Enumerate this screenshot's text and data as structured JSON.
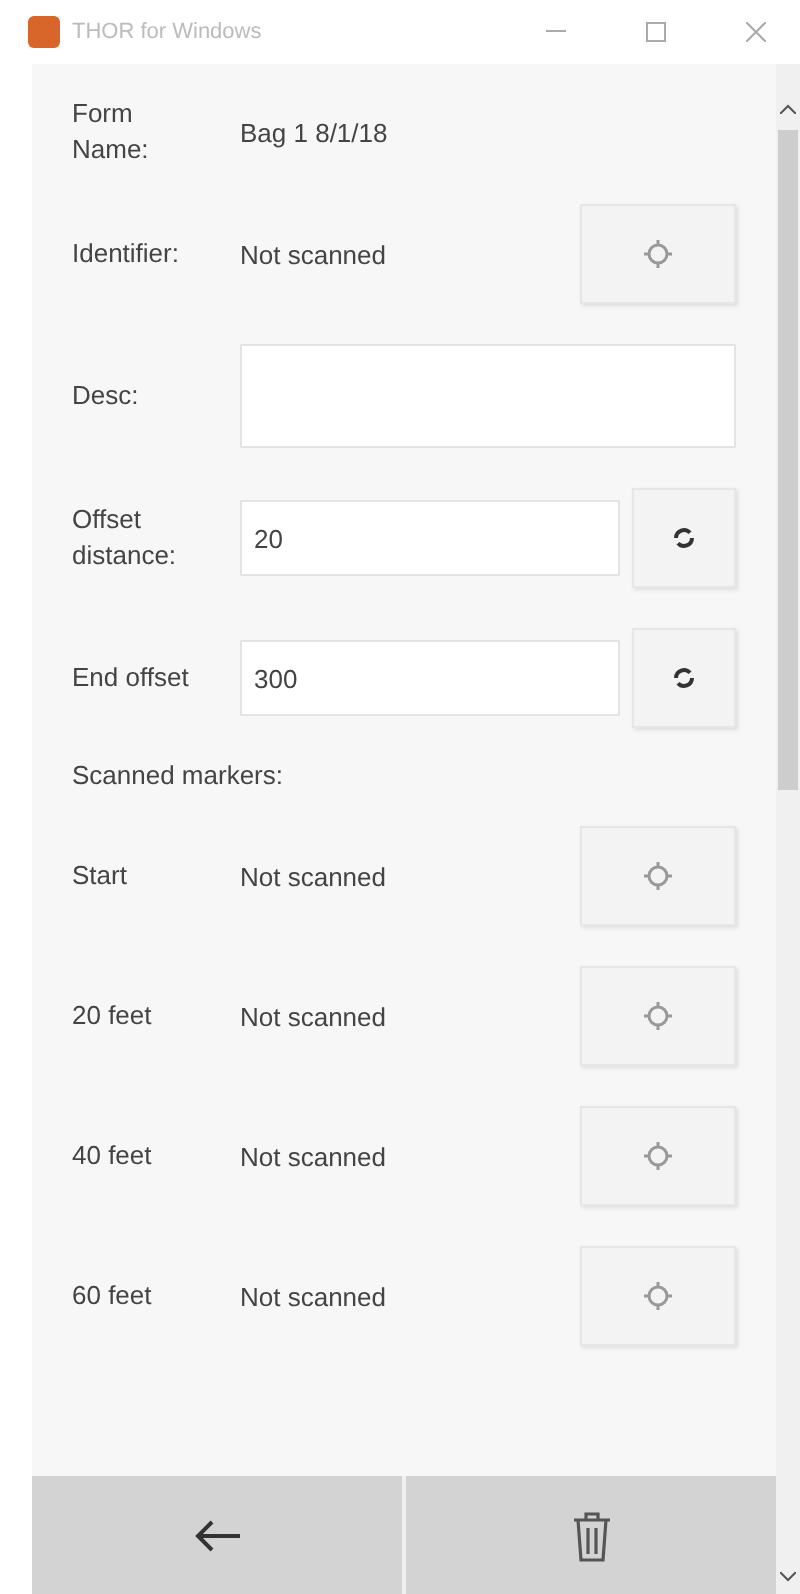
{
  "window": {
    "title": "THOR for Windows"
  },
  "form": [
    {
      "kind": "text",
      "label": "Form Name:",
      "value": "Bag 1 8/1/18"
    },
    {
      "kind": "scan",
      "label": "Identifier:",
      "value": "Not scanned"
    },
    {
      "kind": "input",
      "label": "Desc:"
    },
    {
      "kind": "reset",
      "label": "Offset distance:",
      "value": "20"
    },
    {
      "kind": "reset",
      "label": "End offset",
      "value": "300"
    }
  ],
  "markers_heading": "Scanned markers:",
  "markers": [
    {
      "label": "Start",
      "value": "Not scanned"
    },
    {
      "label": "20 feet",
      "value": "Not scanned"
    },
    {
      "label": "40 feet",
      "value": "Not scanned"
    },
    {
      "label": "60 feet",
      "value": "Not scanned"
    }
  ]
}
